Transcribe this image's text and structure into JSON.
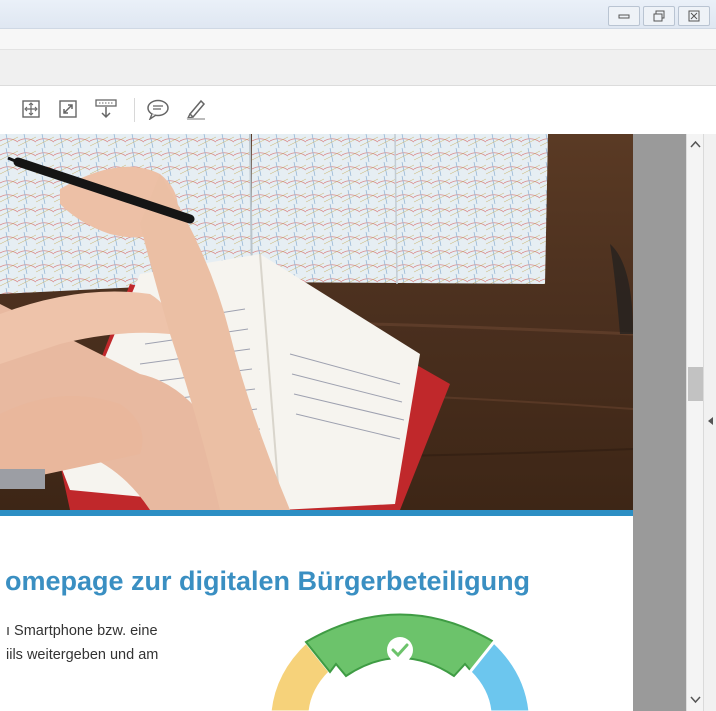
{
  "window": {
    "buttons": [
      "minimize",
      "restore",
      "close"
    ]
  },
  "toolbar": {
    "tools": [
      {
        "name": "fit-page-icon"
      },
      {
        "name": "fullscreen-icon"
      },
      {
        "name": "download-icon"
      },
      {
        "name": "comment-icon"
      },
      {
        "name": "highlight-icon"
      }
    ]
  },
  "document": {
    "heading": "omepage zur digitalen Bürgerbeteiligung",
    "paragraph_lines": [
      "ı Smartphone bzw. eine",
      "iils weitergeben und am"
    ]
  },
  "scroll": {
    "position_fraction": 0.42
  },
  "colors": {
    "heading": "#3a8fc2",
    "accent_bar": "#2c8fc4",
    "segment_green": "#6cc36b",
    "segment_yellow": "#f6d27a",
    "segment_blue": "#6cc6ee"
  }
}
